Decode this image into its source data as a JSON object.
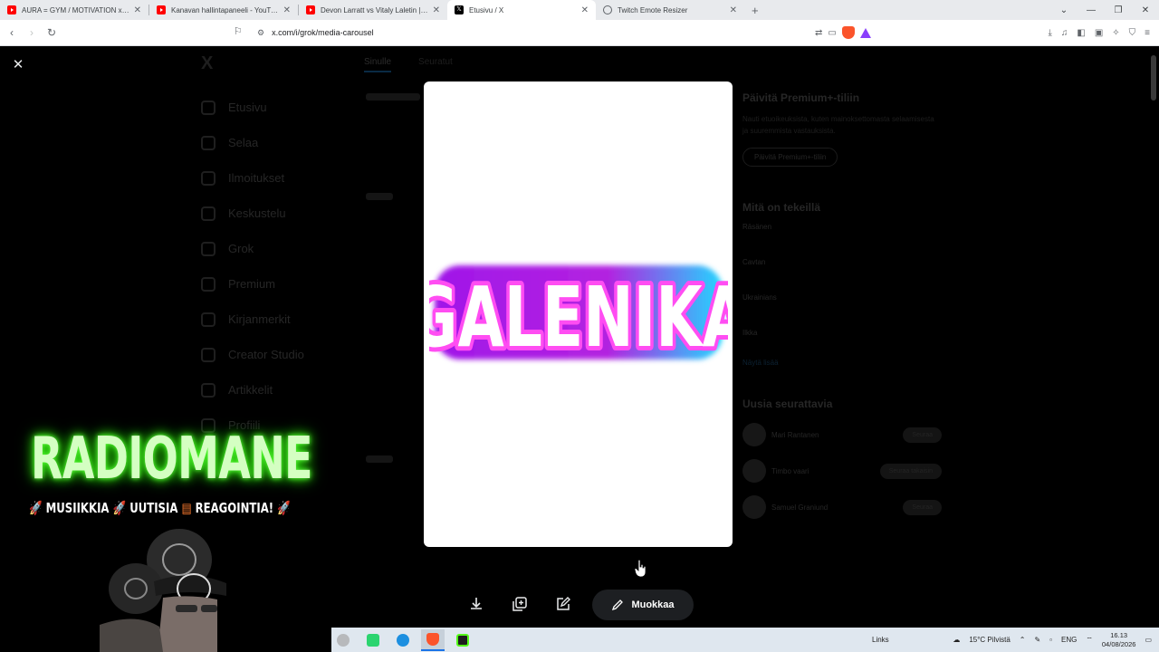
{
  "browser": {
    "tabs": [
      {
        "title": "AURA = GYM / MOTIVATION x Eo",
        "icon": "youtube-icon",
        "active": false
      },
      {
        "title": "Kanavan hallintapaneeli - YouTube St",
        "icon": "youtube-icon",
        "active": false
      },
      {
        "title": "Devon Larratt vs Vitaly Laletin | East v",
        "icon": "youtube-icon",
        "active": false
      },
      {
        "title": "Etusivu / X",
        "icon": "x-icon",
        "active": true
      },
      {
        "title": "Twitch Emote Resizer",
        "icon": "globe-icon",
        "active": false
      }
    ],
    "url": "x.com/i/grok/media-carousel"
  },
  "x_page": {
    "logo": "X",
    "nav": [
      "Etusivu",
      "Selaa",
      "Ilmoitukset",
      "Keskustelu",
      "Grok",
      "Premium",
      "Kirjanmerkit",
      "Creator Studio",
      "Artikkelit",
      "Profiili"
    ],
    "feed_tabs": [
      "Sinulle",
      "Seuratut",
      "",
      "",
      ""
    ],
    "premium": {
      "title": "Päivitä Premium+-tiliin",
      "text": "Nauti etuoikeuksista, kuten mainoksettomasta selaamisesta ja suuremmista vastauksista.",
      "button": "Päivitä Premium+-tiliin"
    },
    "trends_title": "Mitä on tekeillä",
    "trends": [
      {
        "meta": "",
        "name": "Räsänen"
      },
      {
        "meta": "",
        "name": "Cavtan"
      },
      {
        "meta": "",
        "name": "Ukrainians"
      },
      {
        "meta": "",
        "name": "Ilkka"
      }
    ],
    "show_more": "Näytä lisää",
    "follow_title": "Uusia seurattavia",
    "follows": [
      {
        "name": "Mari Rantanen",
        "button": "Seuraa"
      },
      {
        "name": "Timbo vaari",
        "button": "Seuraa takaisin"
      },
      {
        "name": "Samuel Graniund",
        "button": "Seuraa"
      }
    ]
  },
  "media_viewer": {
    "image_text": "GALENIKA",
    "edit_label": "Muokkaa"
  },
  "overlay": {
    "title": "RADIOMANE",
    "tagline_parts": [
      "MUSIIKKIA",
      "UUTISIA",
      "REAGOINTIA!"
    ]
  },
  "taskbar": {
    "links_label": "Links",
    "weather": "15°C  Pilvistä",
    "language": "ENG",
    "time": "16.13",
    "date": "04/08/2026"
  },
  "colors": {
    "galenika_outer": "#9b1de6",
    "galenika_inner": "#ff3df0",
    "galenika_glow": "#18d8ff",
    "radiomane_glow": "#2ee80e"
  }
}
